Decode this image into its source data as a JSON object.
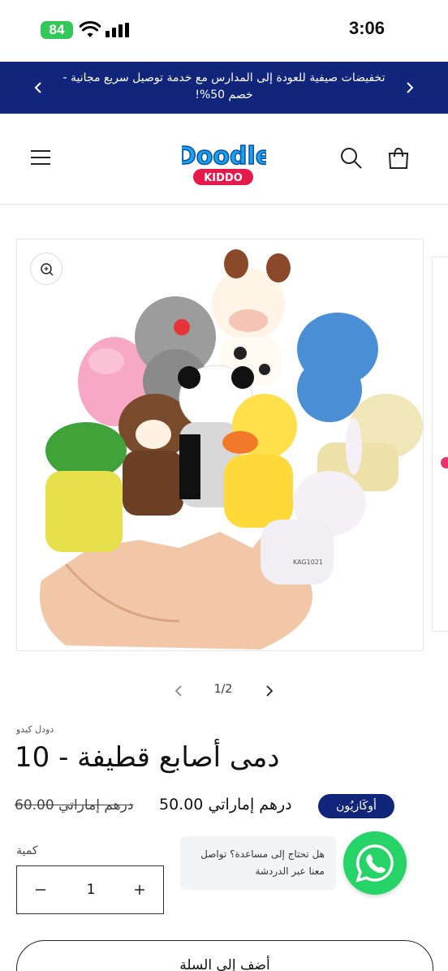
{
  "status_bar": {
    "battery": "84",
    "time": "3:06"
  },
  "announcement": {
    "text": "تخفيضات صيفية للعودة إلى المدارس مع خدمة توصيل سريع مجانية - خصم 50%!"
  },
  "header": {
    "logo_text": "Doodle",
    "logo_sub": "KIDDO"
  },
  "gallery": {
    "counter": "1/2",
    "image_label": "KAG1021"
  },
  "product": {
    "vendor": "دودل كيدو",
    "title": "دمى أصابع قطيفة - 10",
    "compare_price": "60.00 درهم إماراتي",
    "sale_price": "50.00 درهم إماراتي",
    "sale_badge": "أوكَازيُون",
    "quantity_label": "كمية",
    "quantity_value": "1",
    "add_to_cart_label": "أضف إلى السلة"
  },
  "chat": {
    "line1": "هل تحتاج إلى مساعدة؟ تواصل",
    "line2": "معنا عبر الدردشة"
  },
  "colors": {
    "brand_navy": "#11267a",
    "whatsapp_green": "#25d366",
    "battery_green": "#34c759",
    "logo_blue": "#1aa3e8",
    "logo_red": "#e6194b"
  }
}
